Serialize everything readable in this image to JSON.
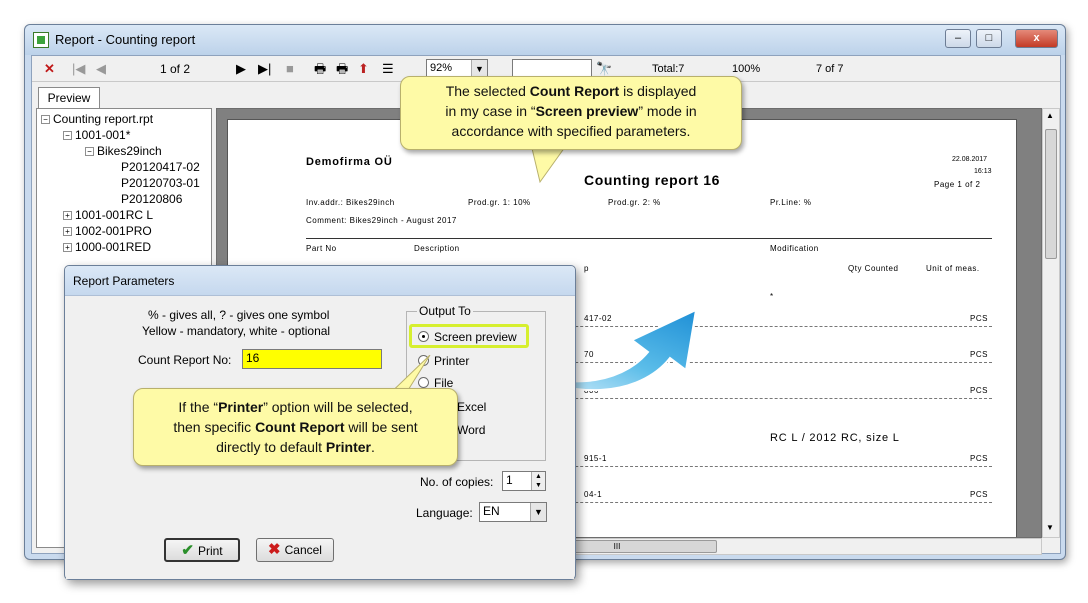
{
  "window": {
    "title": "Report - Counting report",
    "close_symbol": "x",
    "minimize_symbol": "–",
    "maximize_symbol": "□"
  },
  "toolbar": {
    "page_indicator": "1 of 2",
    "zoom_value": "92%",
    "total": "Total:7",
    "percent": "100%",
    "progress": "7 of 7"
  },
  "tabs": {
    "preview": "Preview"
  },
  "tree": [
    {
      "label": "Counting report.rpt",
      "toggle": "−"
    },
    {
      "label": "1001-001*",
      "toggle": "−"
    },
    {
      "label": "Bikes29inch",
      "toggle": "−"
    },
    {
      "label": "P20120417-02",
      "toggle": ""
    },
    {
      "label": "P20120703-01",
      "toggle": ""
    },
    {
      "label": "P20120806",
      "toggle": ""
    },
    {
      "label": "1001-001RC L",
      "toggle": "+"
    },
    {
      "label": "1002-001PRO",
      "toggle": "+"
    },
    {
      "label": "1000-001RED",
      "toggle": "+"
    }
  ],
  "report": {
    "company": "Demofirma OÜ",
    "title": "Counting report  16",
    "date": "22.08.2017",
    "time": "16:13",
    "page": "Page 1 of 2",
    "inv_addr": "Inv.addr.: Bikes29inch",
    "prod_gr1": "Prod.gr. 1: 10%",
    "prod_gr2": "Prod.gr. 2: %",
    "pr_line": "Pr.Line: %",
    "comment": "Comment: Bikes29inch - August 2017",
    "col_part": "Part No",
    "col_desc": "Description",
    "col_mod": "Modification",
    "col_qty": "Qty Counted",
    "col_unit": "Unit of meas.",
    "star": "*",
    "rows": [
      {
        "part": "417-02",
        "unit": "PCS"
      },
      {
        "part": "70",
        "unit": "PCS"
      },
      {
        "part": "806",
        "unit": "PCS"
      },
      {
        "part": "915-1",
        "unit": "PCS",
        "mod": "RC L / 2012 RC, size L"
      },
      {
        "part": "04-1",
        "unit": "PCS"
      }
    ],
    "col_p": "p"
  },
  "hscroll": {
    "thumb": "III"
  },
  "dialog": {
    "title": "Report Parameters",
    "hint1": "% - gives all, ? - gives one symbol",
    "hint2": "Yellow - mandatory, white - optional",
    "count_label": "Count Report No:",
    "count_value": "16",
    "output_legend": "Output To",
    "opt_screen": "Screen preview",
    "opt_printer": "Printer",
    "opt_file": "File",
    "opt_excel": "Excel",
    "opt_word": "Word",
    "copies_label": "No. of copies:",
    "copies_value": "1",
    "language_label": "Language:",
    "language_value": "EN",
    "print": "Print",
    "cancel": "Cancel"
  },
  "callouts": {
    "top": {
      "l1a": "The selected ",
      "l1b": "Count Report",
      "l1c": " is displayed",
      "l2a": "in my case in “",
      "l2b": "Screen preview",
      "l2c": "” mode in",
      "l3": "accordance with specified parameters."
    },
    "bottom": {
      "l1a": "If the “",
      "l1b": "Printer",
      "l1c": "” option will be selected,",
      "l2a": "then specific ",
      "l2b": "Count Report",
      "l2c": " will be sent",
      "l3a": "directly to default ",
      "l3b": "Printer",
      "l3c": "."
    }
  },
  "colors": {
    "accent": "#1e9be0",
    "mandatory": "#ffff00",
    "callout": "#fefaa6",
    "highlight": "#d6ef2f"
  }
}
